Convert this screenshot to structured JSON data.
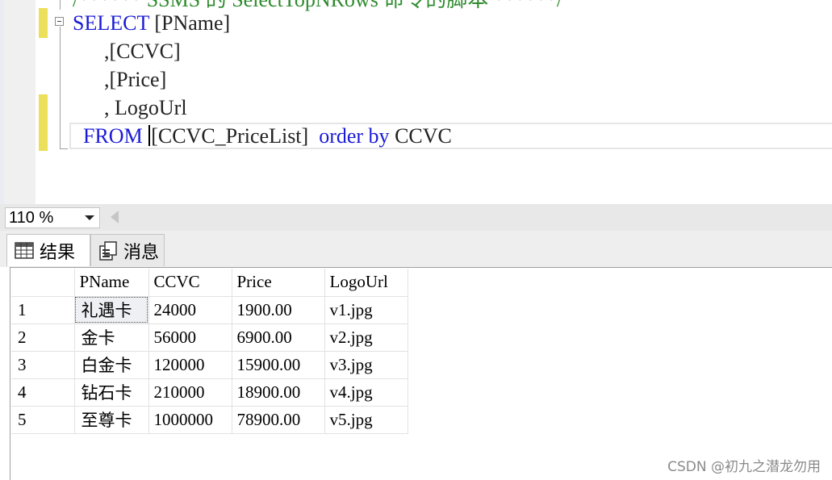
{
  "editor": {
    "comment_line": "/****** SSMS 的 SelectTopNRows 命令的脚本 ******/",
    "line1_keyword": "SELECT",
    "line1_rest": " [PName]",
    "line2": "      ,[CCVC]",
    "line3": "      ,[Price]",
    "line4": "      , LogoUrl",
    "line5_indent": " ",
    "line5_from": "FROM",
    "line5_table": "[CCVC_PriceList]",
    "line5_order": "order by",
    "line5_col": "CCVC"
  },
  "zoom": {
    "value": "110 %"
  },
  "tabs": {
    "results": "结果",
    "messages": "消息"
  },
  "grid": {
    "columns": [
      "PName",
      "CCVC",
      "Price",
      "LogoUrl"
    ],
    "rows": [
      {
        "num": "1",
        "PName": "礼遇卡",
        "CCVC": "24000",
        "Price": "1900.00",
        "LogoUrl": "v1.jpg"
      },
      {
        "num": "2",
        "PName": "金卡",
        "CCVC": "56000",
        "Price": "6900.00",
        "LogoUrl": "v2.jpg"
      },
      {
        "num": "3",
        "PName": "白金卡",
        "CCVC": "120000",
        "Price": "15900.00",
        "LogoUrl": "v3.jpg"
      },
      {
        "num": "4",
        "PName": "钻石卡",
        "CCVC": "210000",
        "Price": "18900.00",
        "LogoUrl": "v4.jpg"
      },
      {
        "num": "5",
        "PName": "至尊卡",
        "CCVC": "1000000",
        "Price": "78900.00",
        "LogoUrl": "v5.jpg"
      }
    ]
  },
  "watermark": "CSDN @初九之潜龙勿用",
  "colors": {
    "keyword": "#1a1ad6",
    "comment": "#2e8b2e",
    "change_mark": "#ecdf5a"
  },
  "icons": {
    "results_tab": "grid-icon",
    "messages_tab": "messages-icon",
    "zoom": "chevron-down-icon"
  }
}
